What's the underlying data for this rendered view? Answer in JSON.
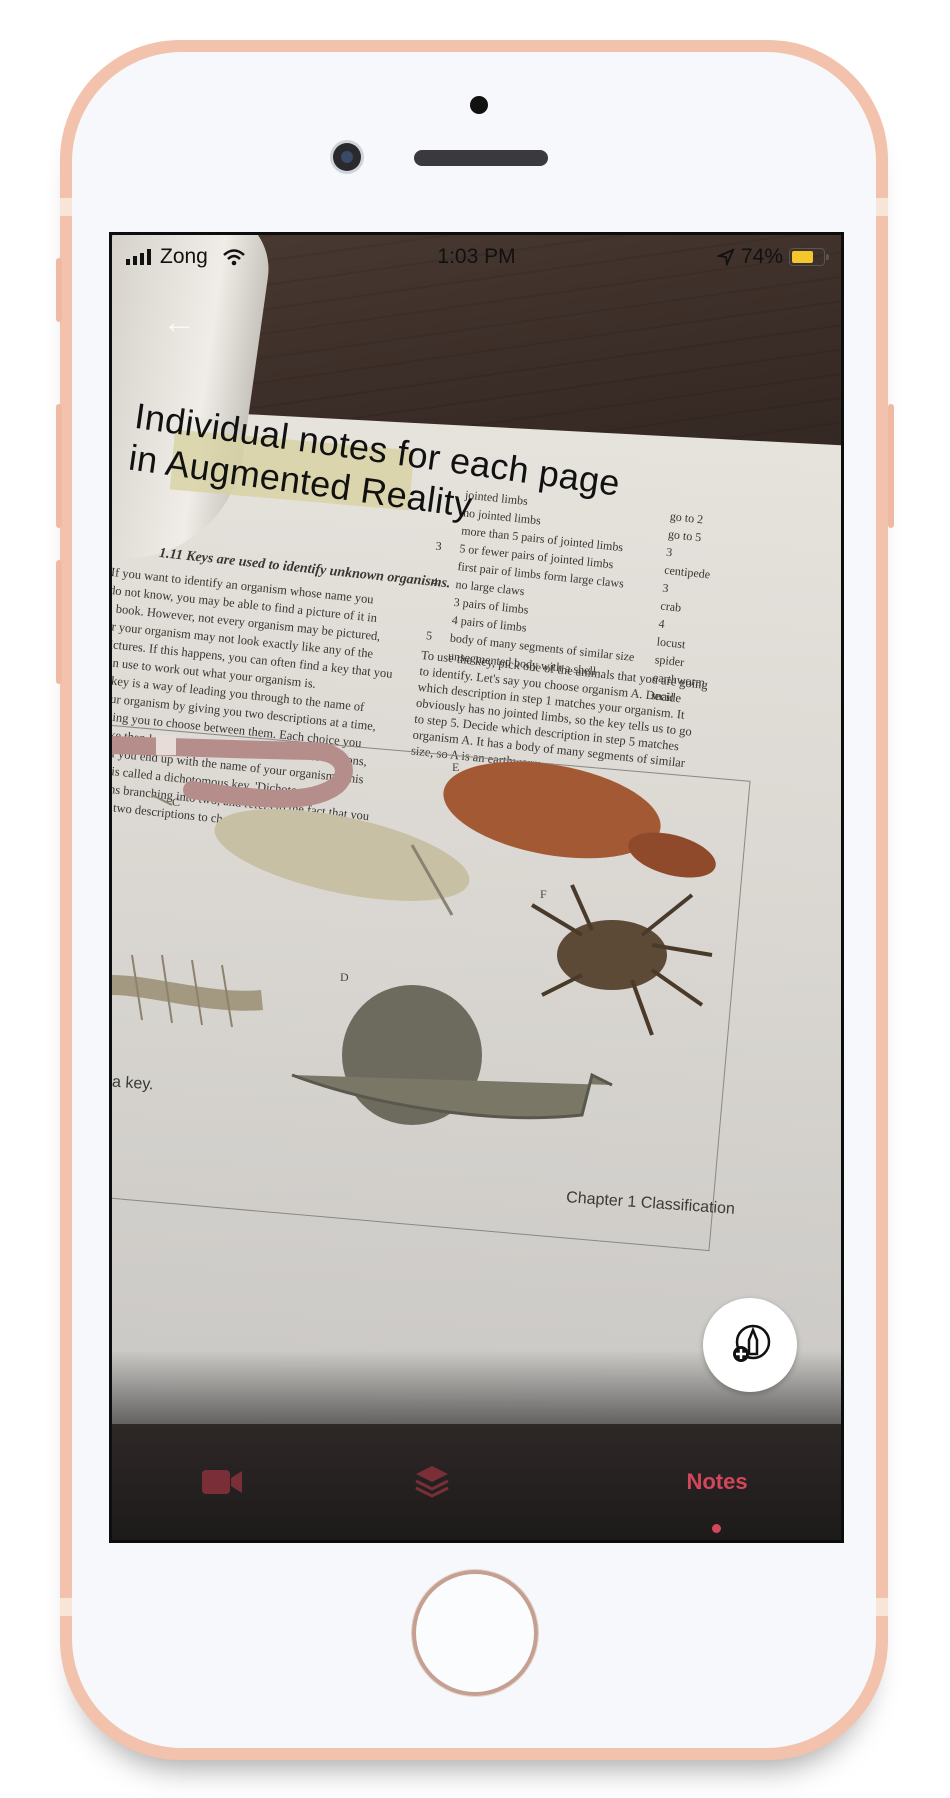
{
  "status_bar": {
    "carrier": "Zong",
    "time": "1:03 PM",
    "battery_percent": "74%",
    "battery_level": 0.74,
    "icons": [
      "signal-bars-icon",
      "wifi-icon",
      "location-arrow-icon",
      "battery-icon"
    ]
  },
  "overlay": {
    "heading_line1": "Individual notes for each page",
    "heading_line2": "in Augmented Reality"
  },
  "book": {
    "heading": "1.11 Keys are used to identify unknown organisms.",
    "left_paragraph": "If you want to identify an organism whose name you\ndo not know, you may be able to find a picture of it in\na book. However, not every organism may be pictured,\nor your organism may not look exactly like any of the\npictures. If this happens, you can often find a key that you\ncan use to work out what your organism is.\nA key is a way of leading you through to the name of\nyour organism by giving you two descriptions at a time,\nasking you to choose between them. Each choice you\nmake then leads you on to another pair of descriptions,\nuntil you end up with the name of your organism. This\nkey is called a dichotomous key. 'Dichotomous'\nmeans branching into two, and refers to the fact that you\nhave two descriptions to choose from at each step.",
    "key_rows": [
      {
        "n": "",
        "text": "jointed limbs",
        "r": "go to 2"
      },
      {
        "n": "",
        "text": "no jointed limbs",
        "r": "go to 5"
      },
      {
        "n": "",
        "text": "more than 5 pairs of jointed limbs",
        "r": "3"
      },
      {
        "n": "3",
        "text": "5 or fewer pairs of jointed limbs",
        "r": "centipede"
      },
      {
        "n": "",
        "text": "first pair of limbs form large claws",
        "r": "3"
      },
      {
        "n": "4",
        "text": "no large claws",
        "r": "crab"
      },
      {
        "n": "",
        "text": "3 pairs of limbs",
        "r": "4"
      },
      {
        "n": "",
        "text": "4 pairs of limbs",
        "r": "locust"
      },
      {
        "n": "5",
        "text": "body of many segments of similar size",
        "r": "spider"
      },
      {
        "n": "",
        "text": "unsegmented body with a shell",
        "r": "earthworm"
      },
      {
        "n": "",
        "text": "",
        "r": "snail"
      }
    ],
    "right_paragraph": "To use the key, pick one of the animals that you are going\nto identify. Let's say you choose organism A. Decide\nwhich description in step 1 matches your organism. It\nobviously has no jointed limbs, so the key tells us to go\nto step 5. Decide which description in step 5 matches\norganism A. It has a body of many segments of similar\nsize, so A is an earthworm.",
    "figure_labels": [
      "C",
      "D",
      "E",
      "F"
    ],
    "figure_caption": "a key.",
    "footer": "Chapter 1 Classification"
  },
  "fab": {
    "icon": "add-annotation-icon"
  },
  "tabbar": {
    "tabs": [
      {
        "name": "video",
        "icon": "video-camera-icon",
        "label": ""
      },
      {
        "name": "layers",
        "icon": "layers-icon",
        "label": ""
      },
      {
        "name": "notes",
        "icon": "",
        "label": "Notes"
      }
    ],
    "active": "notes"
  },
  "colors": {
    "accent": "#d2475b",
    "accent_dim": "#7a2e38",
    "frame": "#f2c2ac"
  }
}
